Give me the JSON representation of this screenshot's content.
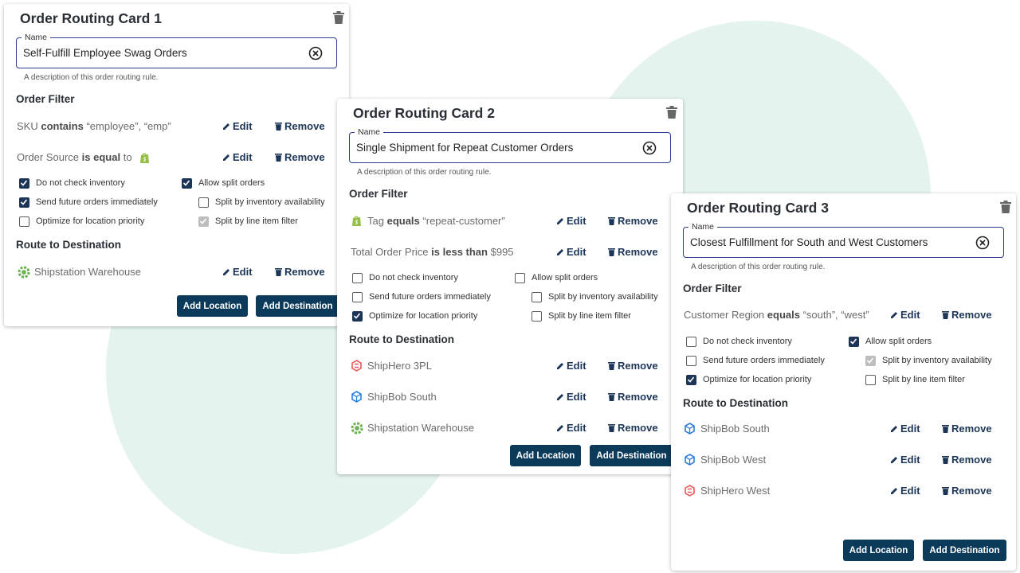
{
  "colors": {
    "accent": "#0c3a5b",
    "link": "#1c3557",
    "background_circle": "#e4f3ee",
    "field_border": "#2b3f8c",
    "shopify_green": "#95bf47",
    "shiphero_red": "#e85a5a",
    "shipbob_blue": "#2b7bdc",
    "shipstation_green": "#6ab04c"
  },
  "common": {
    "name_label": "Name",
    "helper": "A description of this order routing rule.",
    "order_filter": "Order Filter",
    "route_to_destination": "Route to Destination",
    "edit": "Edit",
    "remove": "Remove",
    "add_location": "Add Location",
    "add_destination": "Add Destination"
  },
  "options": {
    "do_not_check": "Do not check inventory",
    "send_future": "Send future orders immediately",
    "optimize_priority": "Optimize for location priority",
    "allow_split": "Allow split orders",
    "split_inventory": "Split by inventory availability",
    "split_line": "Split by line item filter"
  },
  "cards": [
    {
      "title": "Order Routing Card 1",
      "name_value": "Self-Fulfill Employee Swag Orders",
      "filters": [
        {
          "field": "SKU",
          "op": "contains",
          "value": "“employee”, “emp”"
        },
        {
          "field": "Order Source",
          "op": "is equal",
          "value": "to",
          "icon": "shopify-icon"
        }
      ],
      "options_state": {
        "do_not_check": "checked",
        "send_future": "checked",
        "optimize_priority": "unchecked",
        "allow_split": "checked",
        "split_inventory": "unchecked",
        "split_line": "disabled"
      },
      "destinations": [
        {
          "name": "Shipstation Warehouse",
          "icon": "shipstation-icon"
        }
      ]
    },
    {
      "title": "Order Routing Card 2",
      "name_value": "Single Shipment for Repeat Customer Orders",
      "filters": [
        {
          "field": "Tag",
          "op": "equals",
          "value": "“repeat-customer”",
          "icon": "shopify-icon"
        },
        {
          "field": "Total Order Price",
          "op": "is less than",
          "value": "$995"
        }
      ],
      "options_state": {
        "do_not_check": "unchecked",
        "send_future": "unchecked",
        "optimize_priority": "checked",
        "allow_split": "unchecked",
        "split_inventory": "unchecked",
        "split_line": "unchecked"
      },
      "destinations": [
        {
          "name": "ShipHero 3PL",
          "icon": "shiphero-icon"
        },
        {
          "name": "ShipBob South",
          "icon": "shipbob-icon"
        },
        {
          "name": "Shipstation Warehouse",
          "icon": "shipstation-icon"
        }
      ]
    },
    {
      "title": "Order Routing Card 3",
      "name_value": "Closest Fulfillment for South and West Customers",
      "filters": [
        {
          "field": "Customer Region",
          "op": "equals",
          "value": "“south”, “west”"
        }
      ],
      "options_state": {
        "do_not_check": "unchecked",
        "send_future": "unchecked",
        "optimize_priority": "checked",
        "allow_split": "checked",
        "split_inventory": "disabled",
        "split_line": "unchecked"
      },
      "destinations": [
        {
          "name": "ShipBob South",
          "icon": "shipbob-icon"
        },
        {
          "name": "ShipBob West",
          "icon": "shipbob-icon"
        },
        {
          "name": "ShipHero West",
          "icon": "shiphero-icon"
        }
      ]
    }
  ]
}
